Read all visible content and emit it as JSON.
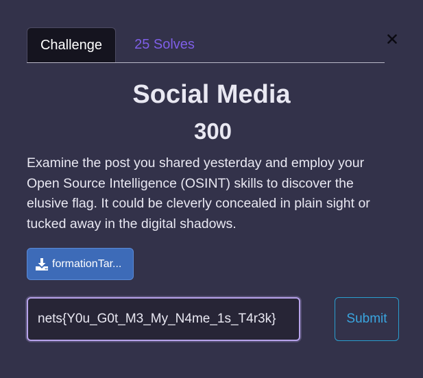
{
  "tabs": {
    "challenge_label": "Challenge",
    "solves_label": "25 Solves"
  },
  "challenge": {
    "name": "Social Media",
    "points": "300",
    "description": "Examine the post you shared yesterday and employ your Open Source Intelligence (OSINT) skills to discover the elusive flag. It could be cleverly concealed in plain sight or tucked away in the digital shadows.",
    "file_label": "formationTar..."
  },
  "form": {
    "flag_value": "nets{Y0u_G0t_M3_My_N4me_1s_T4r3k}",
    "submit_label": "Submit"
  },
  "icons": {
    "close": "close-icon",
    "download": "download-icon"
  },
  "colors": {
    "background": "#33324a",
    "active_tab": "#15141f",
    "solves_link": "#7f5fe8",
    "file_button": "#3d6bb8",
    "submit_accent": "#2a9fd0"
  }
}
